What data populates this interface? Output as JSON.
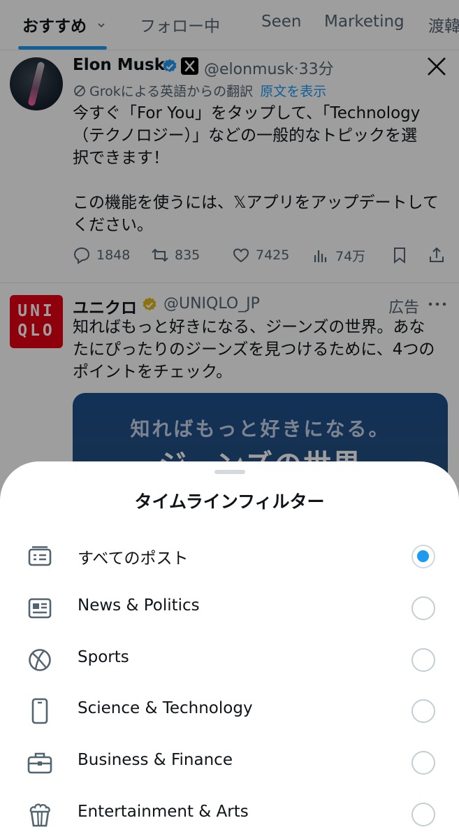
{
  "tabs": {
    "items": [
      {
        "label": "おすすめ"
      },
      {
        "label": "フォロー中"
      },
      {
        "label": "Seen"
      },
      {
        "label": "Marketing"
      },
      {
        "label": "渡韓"
      }
    ]
  },
  "post1": {
    "name": "Elon Musk",
    "handle": "@elonmusk",
    "time": "33分",
    "translated_label": "Grokによる英語からの翻訳",
    "show_original": "原文を表示",
    "text_p1_l1": "今すぐ「For You」をタップして、「Technology",
    "text_p1_l2": "（テクノロジー）」などの一般的なトピックを選",
    "text_p1_l3": "択できます！",
    "text_p2_l1": "この機能を使うには、𝕏アプリをアップデートして",
    "text_p2_l2": "ください。",
    "replies": "1848",
    "reposts": "835",
    "likes": "7425",
    "views": "74万"
  },
  "post2": {
    "name": "ユニクロ",
    "handle": "@UNIQLO_JP",
    "ad_label": "広告",
    "logo_line1": "UNI",
    "logo_line2": "QLO",
    "text_l1": "知ればもっと好きになる、ジーンズの世界。あな",
    "text_l2": "たにぴったりのジーンズを見つけるために、4つの",
    "text_l3": "ポイントをチェック。",
    "promo_line1": "知ればもっと好きになる。",
    "promo_line2": "ジーンズの世界"
  },
  "sheet": {
    "title": "タイムラインフィルター",
    "options": [
      {
        "label": "すべてのポスト",
        "icon": "feed-icon",
        "selected": true
      },
      {
        "label": "News & Politics",
        "icon": "news-icon",
        "selected": false
      },
      {
        "label": "Sports",
        "icon": "ball-icon",
        "selected": false
      },
      {
        "label": "Science & Technology",
        "icon": "phone-icon",
        "selected": false
      },
      {
        "label": "Business & Finance",
        "icon": "briefcase-icon",
        "selected": false
      },
      {
        "label": "Entertainment & Arts",
        "icon": "popcorn-icon",
        "selected": false
      }
    ]
  },
  "colors": {
    "accent": "#1d9bf0",
    "text": "#0f1419",
    "muted": "#536471",
    "verified_gold": "#e2b719",
    "uniqlo_red": "#e60012"
  }
}
